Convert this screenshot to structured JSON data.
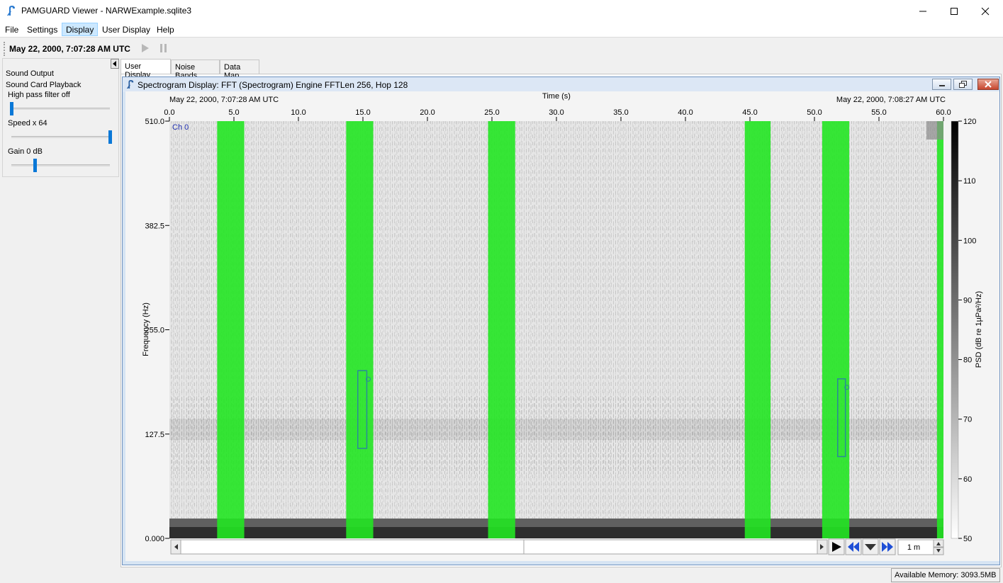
{
  "window": {
    "title": "PAMGUARD Viewer - NARWExample.sqlite3"
  },
  "menu": [
    "File",
    "Settings",
    "Display",
    "User Display",
    "Help"
  ],
  "menu_active": "Display",
  "toolbar": {
    "time": "May 22, 2000, 7:07:28 AM UTC"
  },
  "sound_panel": {
    "heading": "Sound Output",
    "subheading": "Sound Card Playback",
    "filter_label": "High pass filter off",
    "speed_label": "Speed  x 64",
    "gain_label": "Gain 0 dB",
    "filter_level": 0.0,
    "speed_level": 1.0,
    "gain_level": 0.24
  },
  "tabs": [
    "User Display",
    "Noise Bands",
    "Data Map"
  ],
  "active_tab": "User Display",
  "spectrogram": {
    "frame_title": "Spectrogram Display: FFT (Spectrogram) Engine FFTLen 256, Hop 128",
    "start_time": "May 22, 2000, 7:07:28 AM UTC",
    "end_time": "May 22, 2000, 7:08:27 AM UTC",
    "channel_label": "Ch 0",
    "time_window": "1 m"
  },
  "chart_data": {
    "type": "heatmap",
    "xlabel": "Time (s)",
    "ylabel": "Frequency (Hz)",
    "colorbar_label": "PSD (dB re 1µPa²/Hz)",
    "x_ticks": [
      "0.0",
      "5.0",
      "10.0",
      "15.0",
      "20.0",
      "25.0",
      "30.0",
      "35.0",
      "40.0",
      "45.0",
      "50.0",
      "55.0",
      "60.0"
    ],
    "xlim": [
      0,
      60
    ],
    "y_ticks": [
      "510.0",
      "382.5",
      "255.0",
      "127.5",
      "0.000"
    ],
    "ylim": [
      0,
      510
    ],
    "colorbar_ticks": [
      "120",
      "110",
      "100",
      "90",
      "80",
      "70",
      "60",
      "50"
    ],
    "colorbar_range": [
      50,
      120
    ],
    "colormap": "grey (white = low, black = high)",
    "highlight_color": "#22e622",
    "highlight_bands_s": [
      [
        3.7,
        5.8
      ],
      [
        13.7,
        15.8
      ],
      [
        24.7,
        26.8
      ],
      [
        44.6,
        46.6
      ],
      [
        50.6,
        52.7
      ],
      [
        59.5,
        60.0
      ]
    ],
    "detections": [
      {
        "t_start": 14.6,
        "t_end": 15.3,
        "f_low": 110,
        "f_high": 205
      },
      {
        "t_start": 51.8,
        "t_end": 52.4,
        "f_low": 100,
        "f_high": 195
      }
    ]
  },
  "status": {
    "memory": "Available Memory: 3093.5MB"
  }
}
